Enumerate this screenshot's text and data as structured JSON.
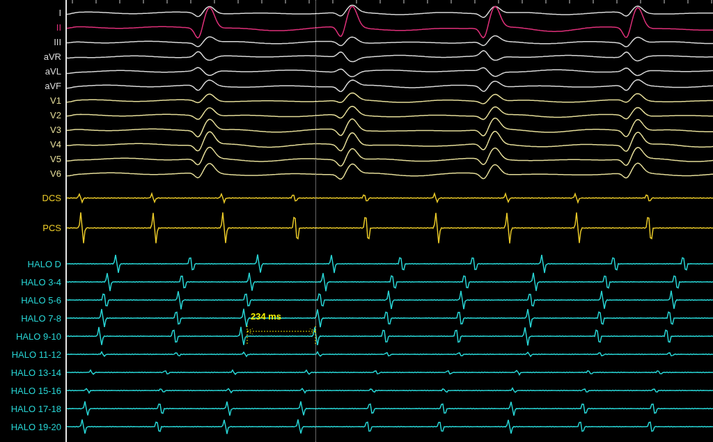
{
  "channels": [
    {
      "label": "I",
      "kind": "surface",
      "color": "#d8d8d8"
    },
    {
      "label": "II",
      "kind": "surface",
      "color": "#e0307a"
    },
    {
      "label": "III",
      "kind": "surface",
      "color": "#d8d8d8"
    },
    {
      "label": "aVR",
      "kind": "surface",
      "color": "#d8d8d8"
    },
    {
      "label": "aVL",
      "kind": "surface",
      "color": "#d8d8d8"
    },
    {
      "label": "aVF",
      "kind": "surface",
      "color": "#d8d8d8"
    },
    {
      "label": "V1",
      "kind": "surface",
      "color": "#e4dc98"
    },
    {
      "label": "V2",
      "kind": "surface",
      "color": "#e4dc98"
    },
    {
      "label": "V3",
      "kind": "surface",
      "color": "#e4dc98"
    },
    {
      "label": "V4",
      "kind": "surface",
      "color": "#e4dc98"
    },
    {
      "label": "V5",
      "kind": "surface",
      "color": "#e4dc98"
    },
    {
      "label": "V6",
      "kind": "surface",
      "color": "#e4dc98"
    },
    {
      "label": "DCS",
      "kind": "cs",
      "color": "#e8c828"
    },
    {
      "label": "PCS",
      "kind": "cs",
      "color": "#e8c828"
    },
    {
      "label": "HALO D",
      "kind": "halo",
      "color": "#28d4d4"
    },
    {
      "label": "HALO 3-4",
      "kind": "halo",
      "color": "#28d4d4"
    },
    {
      "label": "HALO 5-6",
      "kind": "halo",
      "color": "#28d4d4"
    },
    {
      "label": "HALO 7-8",
      "kind": "halo",
      "color": "#28d4d4"
    },
    {
      "label": "HALO 9-10",
      "kind": "halo",
      "color": "#28d4d4"
    },
    {
      "label": "HALO 11-12",
      "kind": "halo",
      "color": "#28d4d4"
    },
    {
      "label": "HALO 13-14",
      "kind": "halo",
      "color": "#28d4d4"
    },
    {
      "label": "HALO 15-16",
      "kind": "halo",
      "color": "#28d4d4"
    },
    {
      "label": "HALO 17-18",
      "kind": "halo",
      "color": "#28d4d4"
    },
    {
      "label": "HALO 19-20",
      "kind": "halo",
      "color": "#28d4d4"
    }
  ],
  "measurement": {
    "label": "234 ms"
  }
}
